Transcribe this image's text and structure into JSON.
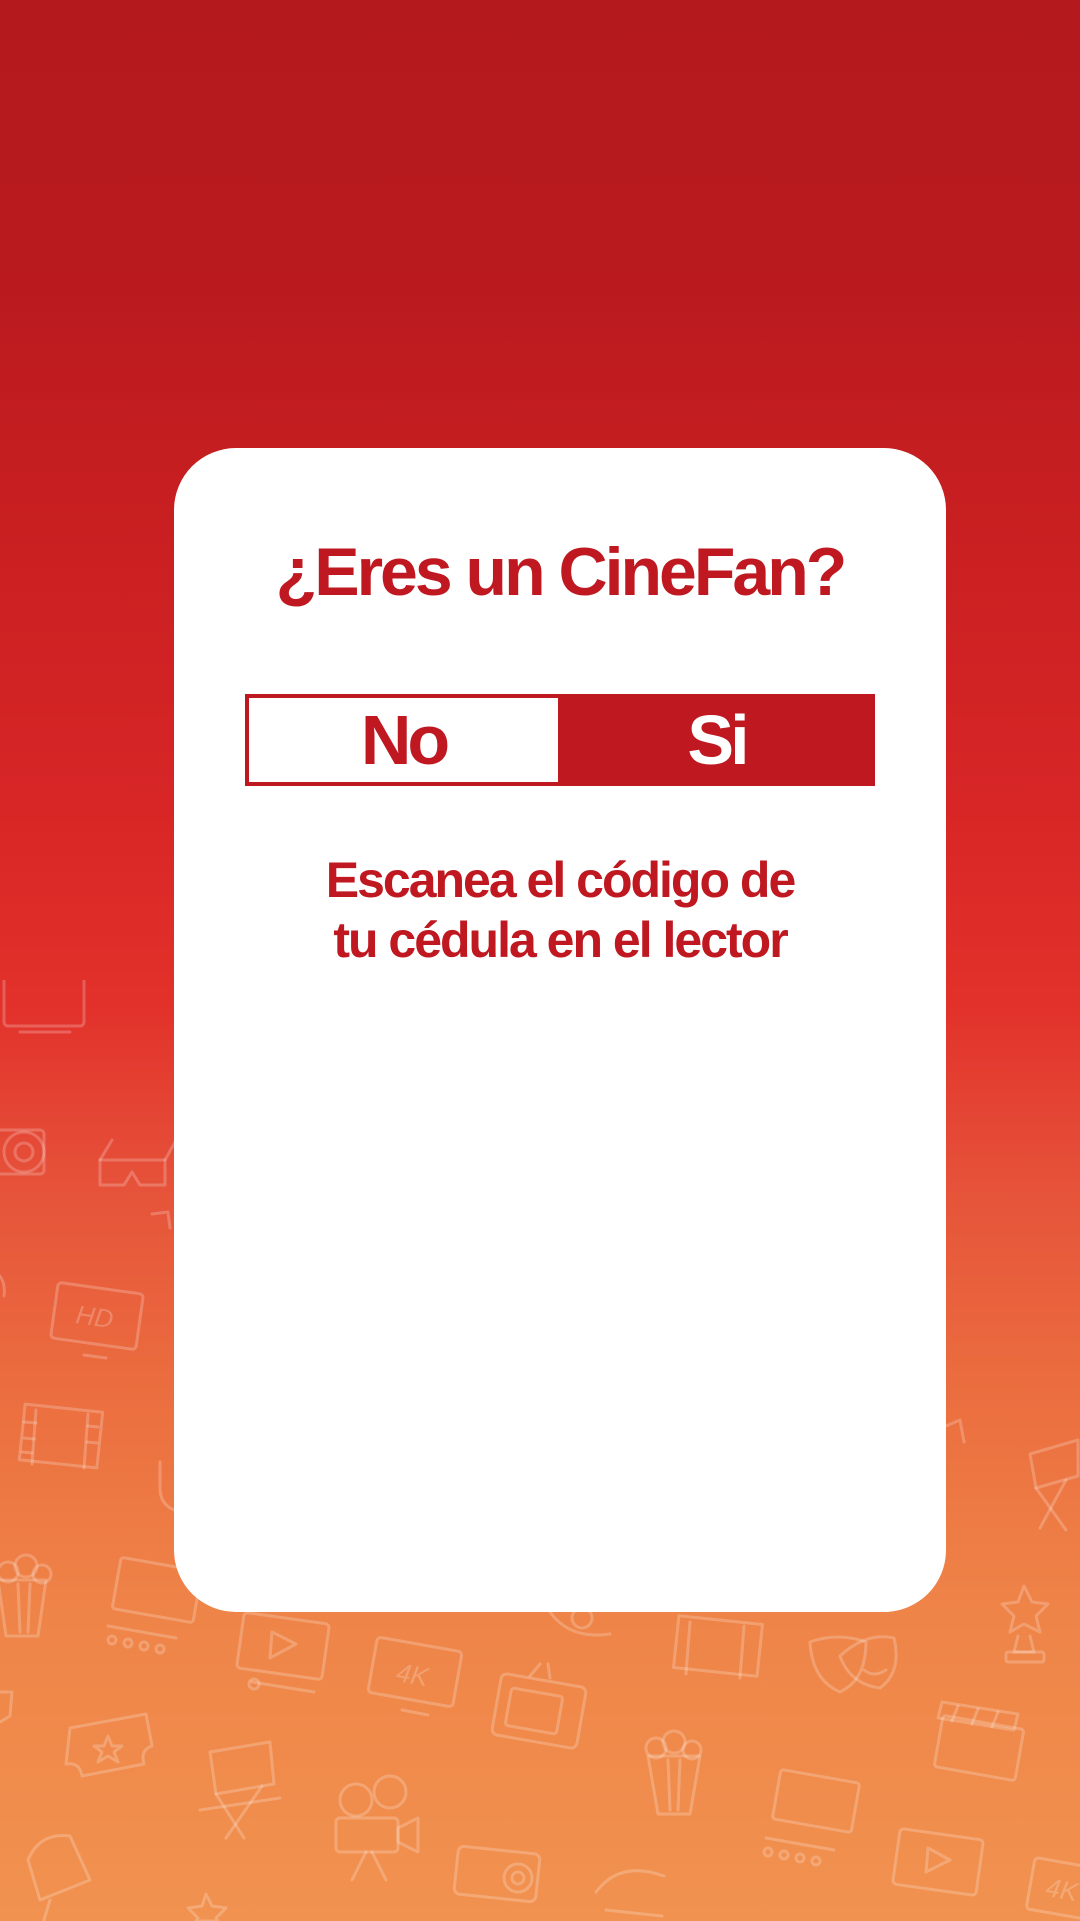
{
  "screen": {
    "background_top": "#b4191d",
    "background_bottom": "#f19250",
    "pattern_icons": [
      "monitor-icon",
      "projector-icon",
      "3d-glasses-icon",
      "hd-tv-icon",
      "film-strip-icon",
      "popcorn-icon",
      "cinema-screen-icon",
      "play-screen-icon",
      "4k-tv-icon",
      "retro-tv-icon",
      "comedy-tragedy-masks-icon",
      "clapperboard-icon",
      "award-star-icon",
      "ticket-icon",
      "director-chair-icon",
      "camera-icon"
    ],
    "pattern_labels": [
      "HD",
      "4K",
      "4K"
    ]
  },
  "card": {
    "title": "¿Eres un CineFan?",
    "toggle": {
      "no_label": "No",
      "si_label": "Si",
      "selected": "Si"
    },
    "instruction": {
      "line1": "Escanea el código de",
      "line2": "tu cédula en el lector"
    }
  },
  "colors": {
    "accent": "#bf1820",
    "card_bg": "#ffffff"
  }
}
